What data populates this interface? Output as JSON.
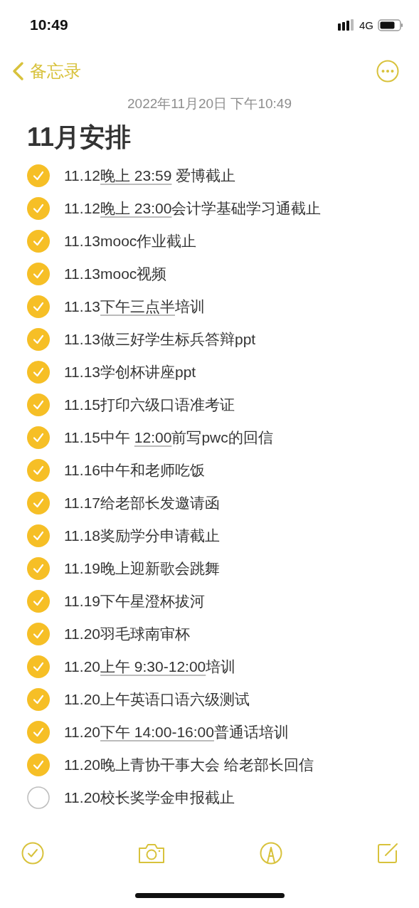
{
  "status_bar": {
    "time": "10:49",
    "network": "4G"
  },
  "nav": {
    "back_label": "备忘录"
  },
  "note": {
    "timestamp": "2022年11月20日 下午10:49",
    "title": "11月安排",
    "items": [
      {
        "checked": true,
        "text": "11.12",
        "link": "晚上 23:59",
        "rest": " 爱博截止"
      },
      {
        "checked": true,
        "text": "11.12",
        "link": "晚上 23:00",
        "rest": "会计学基础学习通截止"
      },
      {
        "checked": true,
        "text": "11.13mooc作业截止"
      },
      {
        "checked": true,
        "text": "11.13mooc视频"
      },
      {
        "checked": true,
        "text": "11.13",
        "link": "下午三点半",
        "rest": "培训"
      },
      {
        "checked": true,
        "text": "11.13做三好学生标兵答辩ppt"
      },
      {
        "checked": true,
        "text": "11.13学创杯讲座ppt"
      },
      {
        "checked": true,
        "text": "11.15打印六级口语准考证"
      },
      {
        "checked": true,
        "text": "11.15中午 ",
        "link": "12:00",
        "rest": "前写pwc的回信"
      },
      {
        "checked": true,
        "text": "11.16中午和老师吃饭"
      },
      {
        "checked": true,
        "text": "11.17给老部长发邀请函"
      },
      {
        "checked": true,
        "text": "11.18奖励学分申请截止"
      },
      {
        "checked": true,
        "text": "11.19晚上迎新歌会跳舞"
      },
      {
        "checked": true,
        "text": "11.19下午星澄杯拔河"
      },
      {
        "checked": true,
        "text": "11.20羽毛球南审杯"
      },
      {
        "checked": true,
        "text": "11.20",
        "link": "上午 9:30-12:00",
        "rest": "培训"
      },
      {
        "checked": true,
        "text": "11.20上午英语口语六级测试"
      },
      {
        "checked": true,
        "text": "11.20",
        "link": "下午 14:00-16:00",
        "rest": "普通话培训"
      },
      {
        "checked": true,
        "text": "11.20晚上青协干事大会 给老部长回信"
      },
      {
        "checked": false,
        "text": "11.20校长奖学金申报截止"
      }
    ]
  }
}
